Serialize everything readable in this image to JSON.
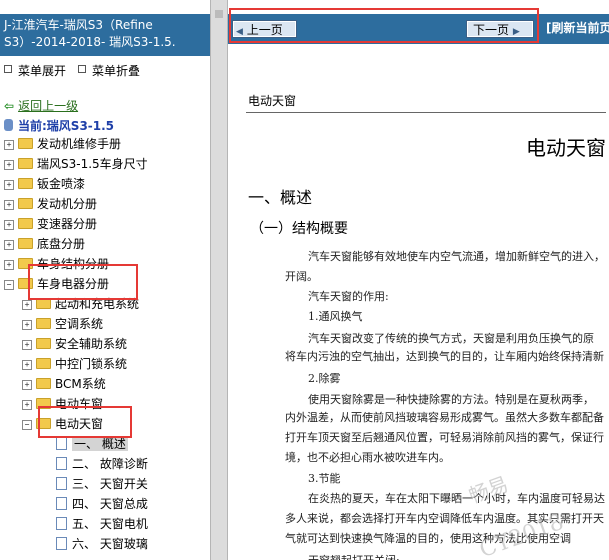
{
  "sidebar": {
    "title": "J-江淮汽车-瑞风S3（Refine S3）-2014-2018- 瑞风S3-1.5.",
    "expand_all": "菜单展开",
    "collapse_all": "菜单折叠",
    "back_link": "返回上一级",
    "current": "当前:瑞风S3-1.5",
    "tree": [
      {
        "label": "发动机维修手册"
      },
      {
        "label": "瑞风S3-1.5车身尺寸"
      },
      {
        "label": "钣金喷漆"
      },
      {
        "label": "发动机分册"
      },
      {
        "label": "变速器分册"
      },
      {
        "label": "底盘分册"
      },
      {
        "label": "车身结构分册"
      },
      {
        "label": "车身电器分册"
      },
      {
        "label": "起动和充电系统"
      },
      {
        "label": "空调系统"
      },
      {
        "label": "安全辅助系统"
      },
      {
        "label": "中控门锁系统"
      },
      {
        "label": "BCM系统"
      },
      {
        "label": "电动车窗"
      },
      {
        "label": "电动天窗"
      },
      {
        "label": "一、 概述"
      },
      {
        "label": "二、 故障诊断"
      },
      {
        "label": "三、 天窗开关"
      },
      {
        "label": "四、 天窗总成"
      },
      {
        "label": "五、 天窗电机"
      },
      {
        "label": "六、 天窗玻璃"
      }
    ]
  },
  "toolbar": {
    "prev": "上一页",
    "next": "下一页",
    "refresh": "[刷新当前页"
  },
  "document": {
    "header": "电动天窗",
    "title": "电动天窗",
    "h2": "一、概述",
    "h3": "（一）结构概要",
    "lines": [
      "汽车天窗能够有效地使车内空气流通，增加新鲜空气的进入，",
      "开阔。",
      "汽车天窗的作用:",
      "1.通风换气",
      "汽车天窗改变了传统的换气方式，天窗是利用负压换气的原",
      "将车内污浊的空气抽出，达到换气的目的，让车厢内始终保持清新",
      "2.除雾",
      "使用天窗除雾是一种快捷除雾的方法。特别是在夏秋两季，",
      "内外温差，从而使前风挡玻璃容易形成雾气。虽然大多数车都配备",
      "打开车顶天窗至后翘通风位置，可轻易消除前风挡的雾气，保证行",
      "境，也不必担心雨水被吹进车内。",
      "3.节能",
      "在炎热的夏天，车在太阳下曝晒一个小时，车内温度可轻易达",
      "多人来说，都会选择打开车内空调降低车内温度。其实只需打开天",
      "气就可达到快速换气降温的目的，使用这种方法比使用空调",
      "天窗翘起打开关闭:"
    ],
    "watermark1": "畅易",
    "watermark2": "CY2018"
  }
}
